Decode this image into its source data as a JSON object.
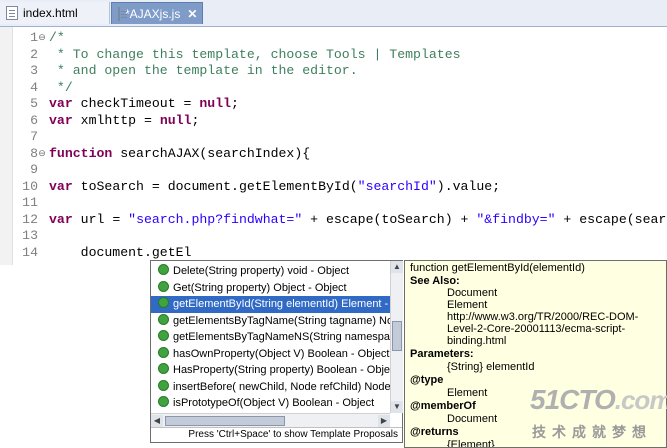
{
  "tabs": [
    {
      "label": "index.html",
      "active": false
    },
    {
      "label": "*AJAXjs.js",
      "active": true
    }
  ],
  "editor": {
    "lines": [
      {
        "num": "1",
        "fold": "⊖",
        "tokens": [
          {
            "t": "/*",
            "c": "cm"
          }
        ]
      },
      {
        "num": "2",
        "fold": "",
        "tokens": [
          {
            "t": " * To change this template, choose Tools | Templates",
            "c": "cm"
          }
        ]
      },
      {
        "num": "3",
        "fold": "",
        "tokens": [
          {
            "t": " * and open the template in the editor.",
            "c": "cm"
          }
        ]
      },
      {
        "num": "4",
        "fold": "",
        "tokens": [
          {
            "t": " */",
            "c": "cm"
          }
        ]
      },
      {
        "num": "5",
        "fold": "",
        "tokens": [
          {
            "t": "var",
            "c": "kw"
          },
          {
            "t": " checkTimeout = ",
            "c": ""
          },
          {
            "t": "null",
            "c": "kw"
          },
          {
            "t": ";",
            "c": ""
          }
        ]
      },
      {
        "num": "6",
        "fold": "",
        "tokens": [
          {
            "t": "var",
            "c": "kw"
          },
          {
            "t": " xmlhttp = ",
            "c": ""
          },
          {
            "t": "null",
            "c": "kw"
          },
          {
            "t": ";",
            "c": ""
          }
        ]
      },
      {
        "num": "7",
        "fold": "",
        "tokens": []
      },
      {
        "num": "8",
        "fold": "⊖",
        "tokens": [
          {
            "t": "function",
            "c": "kw"
          },
          {
            "t": " searchAJAX(searchIndex){",
            "c": ""
          }
        ]
      },
      {
        "num": "9",
        "fold": "",
        "tokens": []
      },
      {
        "num": "10",
        "fold": "",
        "tokens": [
          {
            "t": "var",
            "c": "kw"
          },
          {
            "t": " toSearch = document.getElementById(",
            "c": ""
          },
          {
            "t": "\"searchId\"",
            "c": "str"
          },
          {
            "t": ").value;",
            "c": ""
          }
        ]
      },
      {
        "num": "11",
        "fold": "",
        "tokens": []
      },
      {
        "num": "12",
        "fold": "",
        "tokens": [
          {
            "t": "var",
            "c": "kw"
          },
          {
            "t": " url = ",
            "c": ""
          },
          {
            "t": "\"search.php?findwhat=\"",
            "c": "str"
          },
          {
            "t": " + escape(toSearch) + ",
            "c": ""
          },
          {
            "t": "\"&findby=\"",
            "c": "str"
          },
          {
            "t": " + escape(search",
            "c": ""
          }
        ]
      },
      {
        "num": "13",
        "fold": "",
        "tokens": []
      },
      {
        "num": "14",
        "fold": "",
        "tokens": [
          {
            "t": "    document.getEl",
            "c": ""
          }
        ]
      }
    ]
  },
  "proposals": {
    "items": [
      {
        "label": "Delete(String property)  void - Object",
        "selected": false
      },
      {
        "label": "Get(String property)  Object - Object",
        "selected": false
      },
      {
        "label": "getElementById(String elementId)  Element - D",
        "selected": true
      },
      {
        "label": "getElementsByTagName(String tagname)  Nod",
        "selected": false
      },
      {
        "label": "getElementsByTagNameNS(String namespaceU",
        "selected": false
      },
      {
        "label": "hasOwnProperty(Object V)  Boolean - Object",
        "selected": false
      },
      {
        "label": "HasProperty(String property)  Boolean - Objec",
        "selected": false
      },
      {
        "label": "insertBefore( newChild, Node refChild)  Node -",
        "selected": false
      },
      {
        "label": "isPrototypeOf(Object V)  Boolean - Object",
        "selected": false
      }
    ],
    "footer": "Press 'Ctrl+Space' to show Template Proposals"
  },
  "doc": {
    "lines": [
      {
        "t": "function getElementById(elementId)",
        "s": ""
      },
      {
        "t": "See Also:",
        "s": "b"
      },
      {
        "t": "Document",
        "s": "ind"
      },
      {
        "t": "Element",
        "s": "ind"
      },
      {
        "t": "http://www.w3.org/TR/2000/REC-DOM-",
        "s": "ind"
      },
      {
        "t": "Level-2-Core-20001113/ecma-script-",
        "s": "ind"
      },
      {
        "t": "binding.html",
        "s": "ind"
      },
      {
        "t": "Parameters:",
        "s": "b"
      },
      {
        "t": "{String} elementId",
        "s": "ind"
      },
      {
        "t": "@type",
        "s": "b"
      },
      {
        "t": "Element",
        "s": "ind"
      },
      {
        "t": "@memberOf",
        "s": "b"
      },
      {
        "t": "Document",
        "s": "ind"
      },
      {
        "t": "@returns",
        "s": "b"
      },
      {
        "t": "{Element}",
        "s": "ind"
      }
    ]
  },
  "watermark": {
    "brand": "51CTO",
    "suffix": ".com",
    "tagline": "技术成就梦想"
  }
}
